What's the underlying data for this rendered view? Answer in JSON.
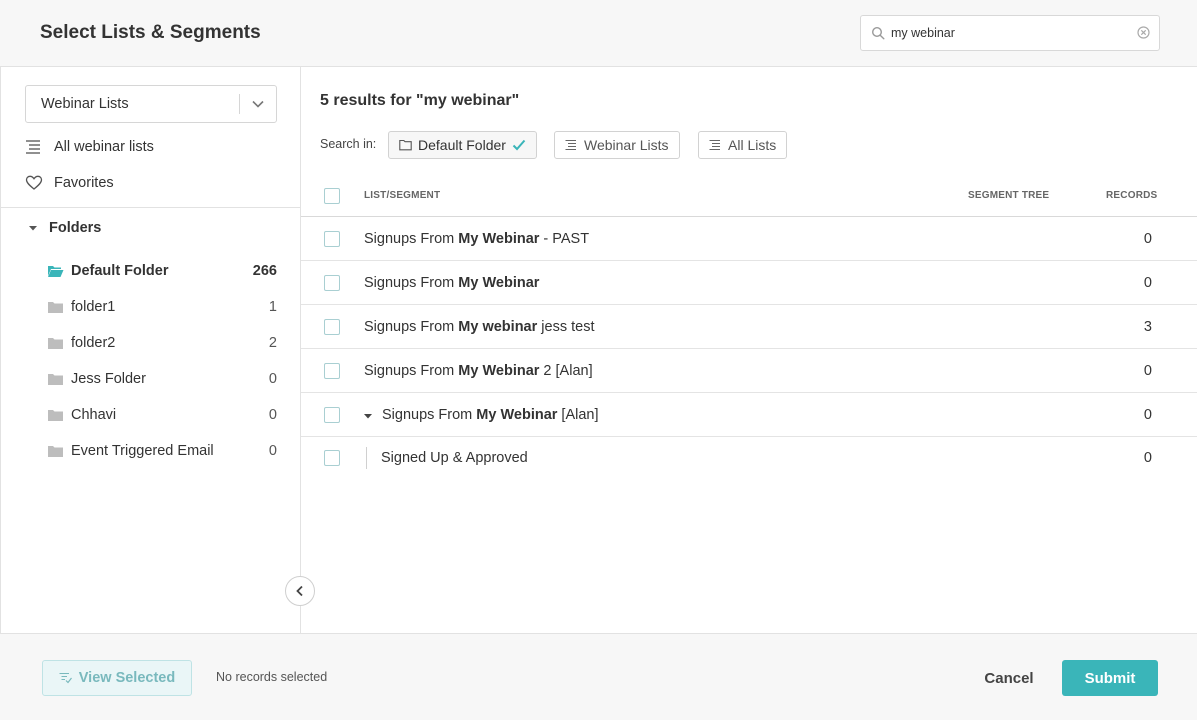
{
  "header": {
    "title": "Select Lists & Segments",
    "search_value": "my webinar"
  },
  "sidebar": {
    "dropdown_value": "Webinar Lists",
    "nav": [
      {
        "label": "All webinar lists",
        "icon": "list-icon"
      },
      {
        "label": "Favorites",
        "icon": "heart-icon"
      }
    ],
    "folders_label": "Folders",
    "folders": [
      {
        "name": "Default Folder",
        "count": "266",
        "active": true
      },
      {
        "name": "folder1",
        "count": "1"
      },
      {
        "name": "folder2",
        "count": "2"
      },
      {
        "name": "Jess Folder",
        "count": "0"
      },
      {
        "name": "Chhavi",
        "count": "0"
      },
      {
        "name": "Event Triggered Email",
        "count": "0"
      }
    ]
  },
  "main": {
    "results_text": "5 results for \"my webinar\"",
    "search_in_label": "Search in:",
    "chips": [
      {
        "label": "Default Folder",
        "icon": "folder-icon",
        "active": true
      },
      {
        "label": "Webinar Lists",
        "icon": "list-icon"
      },
      {
        "label": "All Lists",
        "icon": "list-icon"
      }
    ],
    "columns": {
      "name": "LIST/SEGMENT",
      "tree": "SEGMENT TREE",
      "records": "RECORDS"
    },
    "rows": [
      {
        "pre": "Signups From ",
        "bold": "My Webinar",
        "post": " - PAST",
        "records": "0"
      },
      {
        "pre": "Signups From ",
        "bold": "My Webinar",
        "post": "",
        "records": "0"
      },
      {
        "pre": "Signups From ",
        "bold": "My webinar",
        "post": " jess test",
        "records": "3"
      },
      {
        "pre": "Signups From ",
        "bold": "My Webinar",
        "post": " 2 [Alan]",
        "records": "0"
      },
      {
        "pre": "Signups From ",
        "bold": "My Webinar",
        "post": " [Alan]",
        "records": "0",
        "expanded": true
      },
      {
        "pre": "Signed Up & Approved",
        "bold": "",
        "post": "",
        "records": "0",
        "child": true
      }
    ]
  },
  "footer": {
    "view_selected": "View Selected",
    "no_selection": "No records selected",
    "cancel": "Cancel",
    "submit": "Submit"
  },
  "colors": {
    "accent": "#3ab5b9",
    "folder_active": "#3ab5b9",
    "folder": "#bdbdbd"
  }
}
